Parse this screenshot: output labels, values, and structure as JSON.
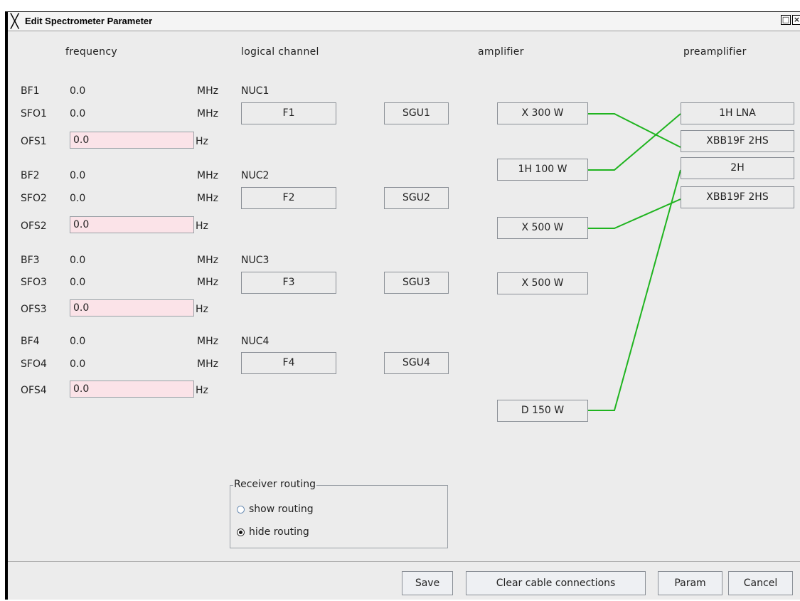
{
  "window": {
    "title": "Edit Spectrometer Parameter",
    "icon": "x-logo-icon",
    "controls": [
      "maximize-icon",
      "close-icon"
    ]
  },
  "headers": {
    "frequency": "frequency",
    "logical_channel": "logical channel",
    "amplifier": "amplifier",
    "preamplifier": "preamplifier"
  },
  "channels": [
    {
      "bf_label": "BF1",
      "bf_value": "0.0",
      "bf_unit": "MHz",
      "nuc": "NUC1",
      "sfo_label": "SFO1",
      "sfo_value": "0.0",
      "sfo_unit": "MHz",
      "logical": "F1",
      "sgu": "SGU1",
      "ofs_label": "OFS1",
      "ofs_value": "0.0",
      "ofs_unit": "Hz"
    },
    {
      "bf_label": "BF2",
      "bf_value": "0.0",
      "bf_unit": "MHz",
      "nuc": "NUC2",
      "sfo_label": "SFO2",
      "sfo_value": "0.0",
      "sfo_unit": "MHz",
      "logical": "F2",
      "sgu": "SGU2",
      "ofs_label": "OFS2",
      "ofs_value": "0.0",
      "ofs_unit": "Hz"
    },
    {
      "bf_label": "BF3",
      "bf_value": "0.0",
      "bf_unit": "MHz",
      "nuc": "NUC3",
      "sfo_label": "SFO3",
      "sfo_value": "0.0",
      "sfo_unit": "MHz",
      "logical": "F3",
      "sgu": "SGU3",
      "ofs_label": "OFS3",
      "ofs_value": "0.0",
      "ofs_unit": "Hz"
    },
    {
      "bf_label": "BF4",
      "bf_value": "0.0",
      "bf_unit": "MHz",
      "nuc": "NUC4",
      "sfo_label": "SFO4",
      "sfo_value": "0.0",
      "sfo_unit": "MHz",
      "logical": "F4",
      "sgu": "SGU4",
      "ofs_label": "OFS4",
      "ofs_value": "0.0",
      "ofs_unit": "Hz"
    }
  ],
  "amplifiers": [
    "X 300 W",
    "1H 100 W",
    "X 500 W",
    "X 500 W",
    "D 150 W"
  ],
  "preamplifiers": [
    "1H LNA",
    "XBB19F 2HS",
    "2H",
    "XBB19F 2HS"
  ],
  "cable_color": "#1fb41f",
  "routing": {
    "title": "Receiver routing",
    "options": [
      {
        "label": "show routing",
        "checked": false
      },
      {
        "label": "hide routing",
        "checked": true
      }
    ]
  },
  "buttons": {
    "save": "Save",
    "clear": "Clear cable connections",
    "param": "Param",
    "cancel": "Cancel"
  }
}
